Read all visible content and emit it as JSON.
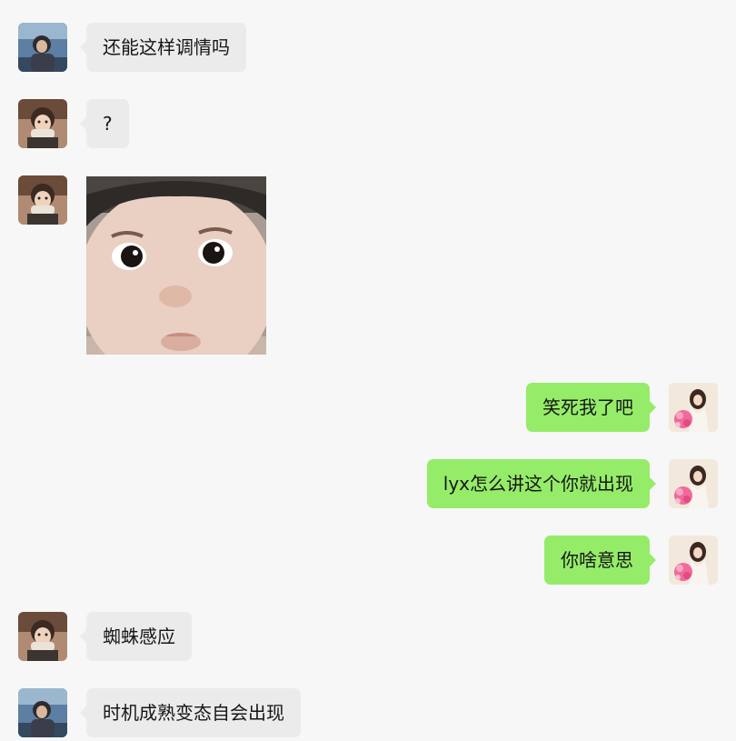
{
  "chat": {
    "messages": [
      {
        "side": "left",
        "sender": "friend-a",
        "type": "text",
        "text": "还能这样调情吗"
      },
      {
        "side": "left",
        "sender": "friend-b",
        "type": "text",
        "text": "?"
      },
      {
        "side": "left",
        "sender": "friend-b",
        "type": "image",
        "image": "baby-face-sticker"
      },
      {
        "side": "right",
        "sender": "self",
        "type": "text",
        "text": "笑死我了吧"
      },
      {
        "side": "right",
        "sender": "self",
        "type": "text",
        "text": "lyx怎么讲这个你就出现"
      },
      {
        "side": "right",
        "sender": "self",
        "type": "text",
        "text": "你啥意思"
      },
      {
        "side": "left",
        "sender": "friend-b",
        "type": "text",
        "text": "蜘蛛感应"
      },
      {
        "side": "left",
        "sender": "friend-a",
        "type": "text",
        "text": "时机成熟变态自会出现"
      }
    ]
  },
  "colors": {
    "background": "#f7f7f7",
    "incoming_bubble": "#ebebeb",
    "outgoing_bubble": "#95ec69"
  }
}
